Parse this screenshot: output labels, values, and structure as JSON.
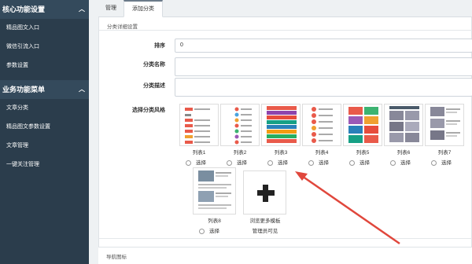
{
  "sidebar": {
    "section1": "核心功能设置",
    "section1_items": [
      "精品图文入口",
      "微信引流入口",
      "参数设置"
    ],
    "section2": "业务功能菜单",
    "section2_items": [
      "文章分类",
      "精品图文参数设置",
      "文章管理",
      "一键关注管理"
    ]
  },
  "tabs": {
    "tab1": "管理",
    "tab2": "添加分类"
  },
  "panel": {
    "title": "分类详细设置",
    "sort_label": "排序",
    "sort_value": "0",
    "name_label": "分类名称",
    "desc_label": "分类描述",
    "style_label": "选择分类风格"
  },
  "templates": [
    {
      "label": "列表1",
      "select": "选择"
    },
    {
      "label": "列表2",
      "select": "选择"
    },
    {
      "label": "列表3",
      "select": "选择"
    },
    {
      "label": "列表4",
      "select": "选择"
    },
    {
      "label": "列表5",
      "select": "选择"
    },
    {
      "label": "列表6",
      "select": "选择"
    },
    {
      "label": "列表7",
      "select": "选择"
    },
    {
      "label": "列表8",
      "select": "选择"
    }
  ],
  "more_templates": {
    "label": "浏览更多模板",
    "note": "管理员可见"
  },
  "bottom": {
    "label": "导航图标"
  },
  "colors": {
    "sidebar": "#2b3d4c",
    "arrow": "#e0473c"
  }
}
